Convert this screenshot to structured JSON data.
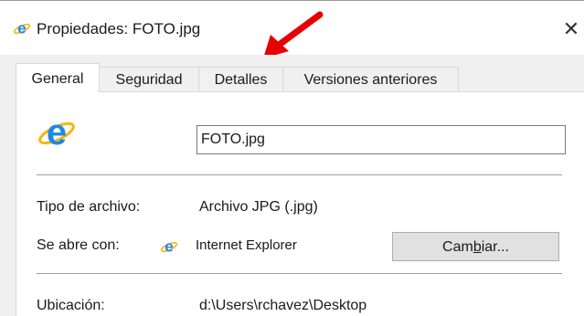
{
  "window": {
    "title": "Propiedades: FOTO.jpg",
    "icon": "internet-explorer-icon",
    "close_glyph": "✕"
  },
  "tabs": [
    {
      "label": "General",
      "active": true
    },
    {
      "label": "Seguridad",
      "active": false
    },
    {
      "label": "Detalles",
      "active": false
    },
    {
      "label": "Versiones anteriores",
      "active": false
    }
  ],
  "annotation": {
    "arrow_color": "#e60000",
    "points_to": "Detalles"
  },
  "general": {
    "file_icon": "internet-explorer-icon",
    "file_name": "FOTO.jpg",
    "file_type_label": "Tipo de archivo:",
    "file_type_value": "Archivo JPG (.jpg)",
    "opens_with_label": "Se abre con:",
    "opens_with_app": "Internet Explorer",
    "change_button": {
      "before": "Cam",
      "mnemonic": "b",
      "after": "iar..."
    },
    "location_label": "Ubicación:",
    "location_value": "d:\\Users\\rchavez\\Desktop"
  },
  "colors": {
    "ie_blue": "#1e88e5",
    "ie_ring": "#f6b60d"
  }
}
